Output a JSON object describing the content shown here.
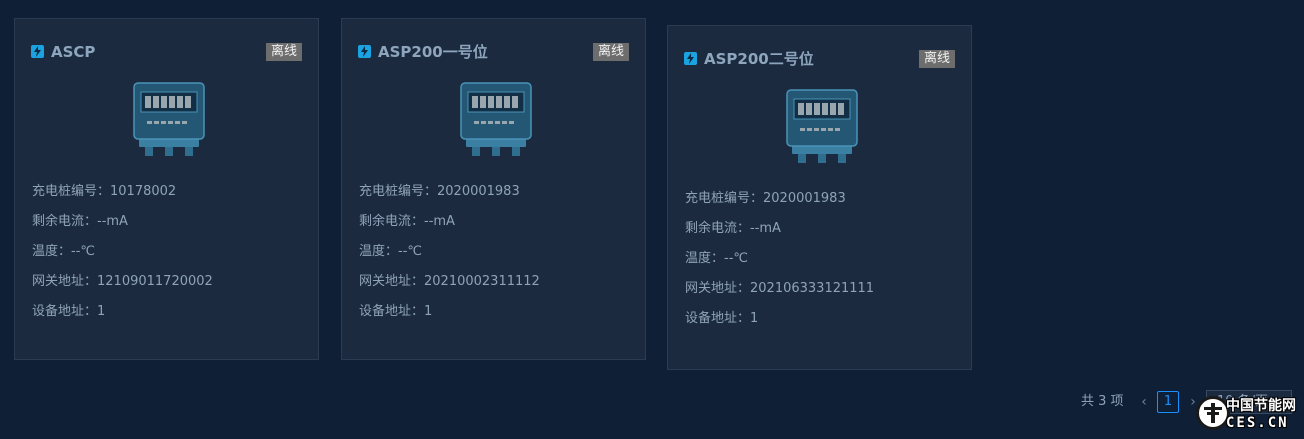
{
  "cards": [
    {
      "title": "ASCP",
      "status": "离线",
      "fields": [
        "充电桩编号：10178002",
        "剩余电流：--mA",
        "温度：--℃",
        "网关地址：12109011720002",
        "设备地址：1"
      ]
    },
    {
      "title": "ASP200一号位",
      "status": "离线",
      "fields": [
        "充电桩编号：2020001983",
        "剩余电流：--mA",
        "温度：--℃",
        "网关地址：20210002311112",
        "设备地址：1"
      ]
    },
    {
      "title": "ASP200二号位",
      "status": "离线",
      "fields": [
        "充电桩编号：2020001983",
        "剩余电流：--mA",
        "温度：--℃",
        "网关地址：202106333121111",
        "设备地址：1"
      ]
    }
  ],
  "pagination": {
    "total_label": "共 3 项",
    "prev_icon": "chevron-left-icon",
    "next_icon": "chevron-right-icon",
    "current_page": "1",
    "page_size": "10 条/页"
  },
  "watermark": {
    "title": "中国节能网",
    "subtitle": "CES.CN"
  },
  "colors": {
    "background": "#0f1f36",
    "card": "#1b2a3e",
    "accent": "#1890ff",
    "badge": "#6d6d6d"
  }
}
